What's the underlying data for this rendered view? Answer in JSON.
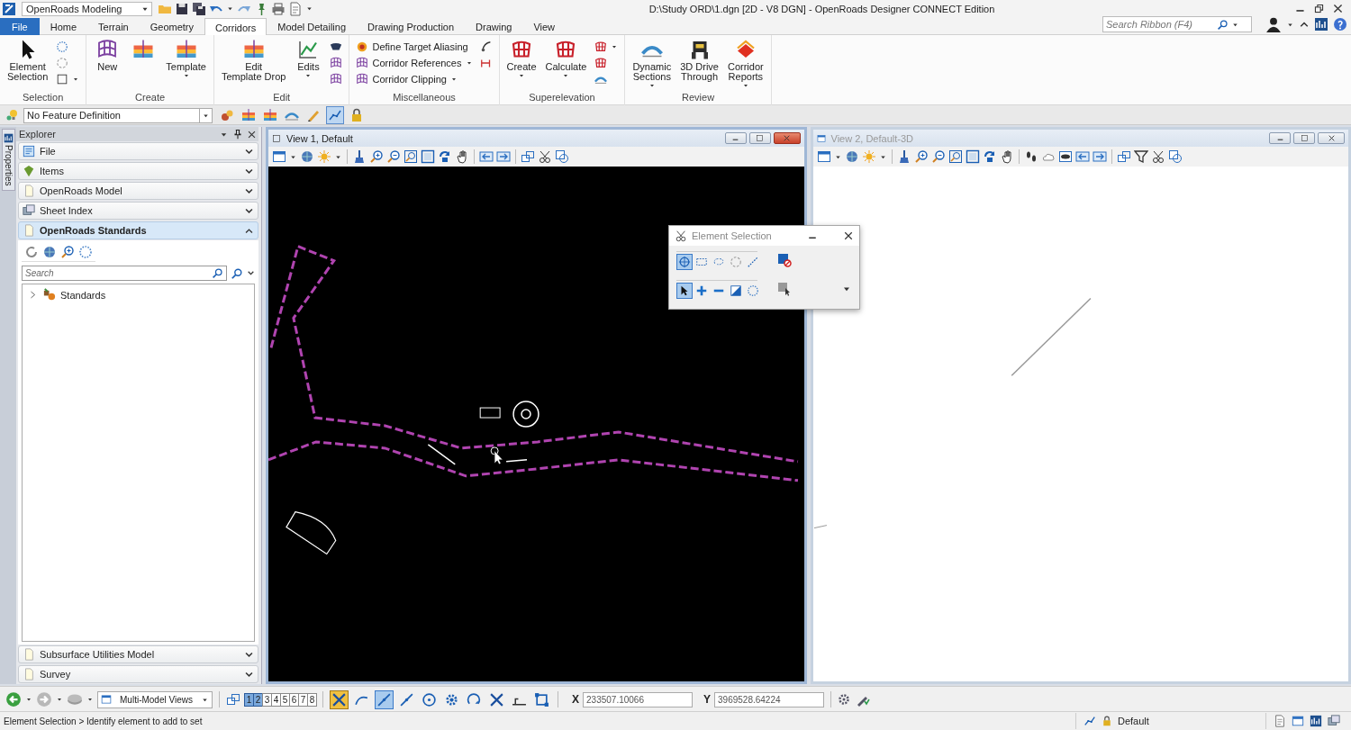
{
  "title_bar": {
    "workflow": "OpenRoads Modeling",
    "title": "D:\\Study ORD\\1.dgn [2D - V8 DGN] - OpenRoads Designer CONNECT Edition"
  },
  "ribbon_tabs": [
    {
      "label": "File",
      "kind": "backstage",
      "selected": false
    },
    {
      "label": "Home",
      "kind": "tab",
      "selected": false
    },
    {
      "label": "Terrain",
      "kind": "tab",
      "selected": false
    },
    {
      "label": "Geometry",
      "kind": "tab",
      "selected": false
    },
    {
      "label": "Corridors",
      "kind": "tab",
      "selected": true
    },
    {
      "label": "Model Detailing",
      "kind": "tab",
      "selected": false
    },
    {
      "label": "Drawing Production",
      "kind": "tab",
      "selected": false
    },
    {
      "label": "Drawing",
      "kind": "tab",
      "selected": false
    },
    {
      "label": "View",
      "kind": "tab",
      "selected": false
    }
  ],
  "ribbon_search": {
    "placeholder": "Search Ribbon (F4)"
  },
  "ribbon_groups": [
    {
      "label": "Selection",
      "tools": [
        {
          "kind": "large",
          "label": "Element\nSelection",
          "menu": false
        },
        {
          "kind": "column",
          "items": [
            {
              "menu": false
            },
            {
              "menu": false
            },
            {
              "menu": true
            }
          ]
        }
      ]
    },
    {
      "label": "Create",
      "tools": [
        {
          "kind": "large",
          "label": "New",
          "menu": false
        },
        {
          "kind": "large",
          "menu": false
        },
        {
          "kind": "large",
          "label": "Template",
          "menu": true
        }
      ]
    },
    {
      "label": "Edit",
      "tools": [
        {
          "kind": "large",
          "label": "Edit\nTemplate Drop",
          "menu": false
        },
        {
          "kind": "large",
          "label": "Edits",
          "menu": true
        },
        {
          "kind": "column",
          "items": [
            {
              "menu": false
            },
            {
              "menu": false
            },
            {
              "menu": false
            }
          ]
        }
      ]
    },
    {
      "label": "Miscellaneous",
      "tools": [
        {
          "kind": "column",
          "items": [
            {
              "label": "Define Target Aliasing",
              "menu": false
            },
            {
              "label": "Corridor References",
              "menu": true
            },
            {
              "label": "Corridor Clipping",
              "menu": true
            }
          ]
        },
        {
          "kind": "column",
          "items": [
            {
              "menu": false
            },
            {
              "menu": false
            }
          ]
        }
      ]
    },
    {
      "label": "Superelevation",
      "tools": [
        {
          "kind": "large",
          "label": "Create",
          "menu": true
        },
        {
          "kind": "large",
          "label": "Calculate",
          "menu": true
        },
        {
          "kind": "column",
          "items": [
            {
              "menu": true
            },
            {
              "menu": false
            },
            {
              "menu": false
            }
          ]
        }
      ]
    },
    {
      "label": "Review",
      "tools": [
        {
          "kind": "large",
          "label": "Dynamic\nSections",
          "menu": true
        },
        {
          "kind": "large",
          "label": "3D Drive\nThrough",
          "menu": false
        },
        {
          "kind": "large",
          "label": "Corridor\nReports",
          "menu": true
        }
      ]
    }
  ],
  "feature_toolbar": {
    "feature": "No Feature Definition",
    "tools": [
      {
        "selected": false
      },
      {
        "selected": false
      },
      {
        "selected": false
      },
      {
        "selected": false
      },
      {
        "selected": false
      },
      {
        "selected": true
      },
      {
        "selected": false
      }
    ]
  },
  "explorer": {
    "title": "Explorer",
    "side_tab": "Properties",
    "sections": [
      {
        "label": "File",
        "expanded": false
      },
      {
        "label": "Items",
        "expanded": false
      },
      {
        "label": "OpenRoads Model",
        "expanded": false
      },
      {
        "label": "Sheet Index",
        "expanded": false
      },
      {
        "label": "OpenRoads Standards",
        "expanded": true,
        "search": {
          "placeholder": "Search"
        },
        "tree": [
          {
            "label": "Standards",
            "expanded": false
          }
        ]
      },
      {
        "label": "Subsurface Utilities Model",
        "expanded": false
      },
      {
        "label": "Survey",
        "expanded": false
      }
    ]
  },
  "views": [
    {
      "title": "View 1, Default",
      "active": true,
      "kind": "plan"
    },
    {
      "title": "View 2, Default-3D",
      "active": false,
      "kind": "perspective"
    }
  ],
  "selection_dialog": {
    "title": "Element Selection",
    "methods": [
      {
        "selected": true
      },
      {
        "selected": false
      },
      {
        "selected": false
      },
      {
        "selected": false
      },
      {
        "selected": false
      }
    ],
    "modes": [
      {
        "selected": true
      },
      {
        "selected": false
      },
      {
        "selected": false
      },
      {
        "selected": false
      },
      {
        "selected": false
      }
    ]
  },
  "bottom_toolbar": {
    "view_group": "Multi-Model Views",
    "views": [
      {
        "label": "1",
        "selected": true
      },
      {
        "label": "2",
        "selected": true
      },
      {
        "label": "3",
        "selected": false
      },
      {
        "label": "4",
        "selected": false
      },
      {
        "label": "5",
        "selected": false
      },
      {
        "label": "6",
        "selected": false
      },
      {
        "label": "7",
        "selected": false
      },
      {
        "label": "8",
        "selected": false
      }
    ],
    "snaps": [
      {
        "selected": true
      },
      {
        "selected": false
      },
      {
        "selected": true
      },
      {
        "selected": false
      },
      {
        "selected": false
      },
      {
        "selected": false
      },
      {
        "selected": false
      },
      {
        "selected": false
      },
      {
        "selected": false
      },
      {
        "selected": false
      }
    ],
    "coordinates": [
      {
        "label": "X",
        "value": "233507.10066"
      },
      {
        "label": "Y",
        "value": "3969528.64224"
      }
    ]
  },
  "status_bar": {
    "message": "Element Selection > Identify element to add to set",
    "level": "Default"
  }
}
